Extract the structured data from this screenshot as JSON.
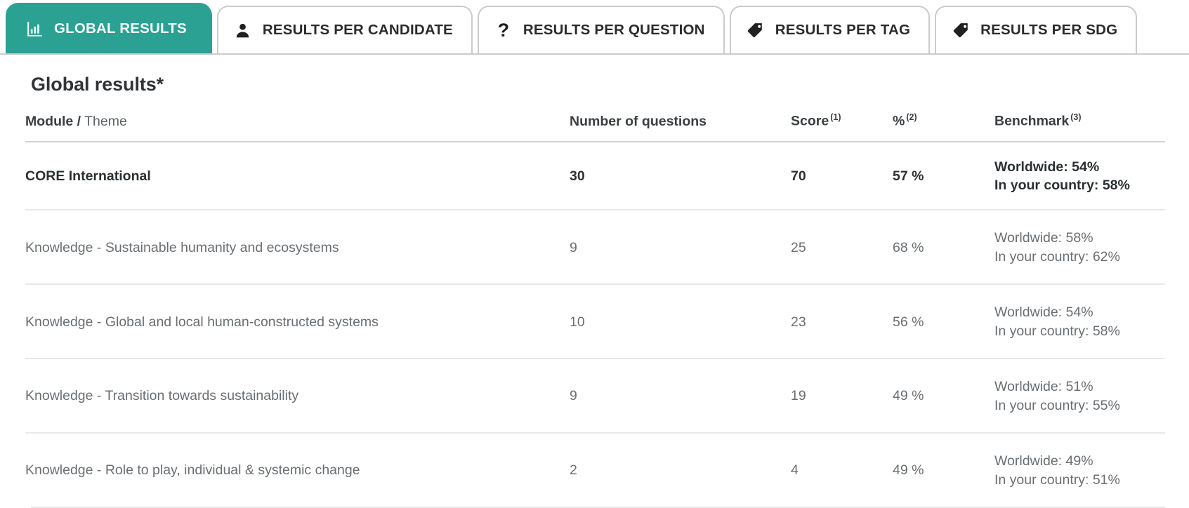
{
  "tabs": [
    {
      "label": "GLOBAL RESULTS",
      "icon": "bar-chart-icon",
      "active": true
    },
    {
      "label": "RESULTS PER CANDIDATE",
      "icon": "person-icon",
      "active": false
    },
    {
      "label": "RESULTS PER QUESTION",
      "icon": "question-mark-icon",
      "active": false
    },
    {
      "label": "RESULTS PER TAG",
      "icon": "tag-icon",
      "active": false
    },
    {
      "label": "RESULTS PER SDG",
      "icon": "tag-icon",
      "active": false
    }
  ],
  "page": {
    "title": "Global results*"
  },
  "table": {
    "headers": {
      "theme_strong": "Module /",
      "theme_light": " Theme",
      "questions": "Number of questions",
      "score": "Score",
      "score_note": "(1)",
      "pct": "%",
      "pct_note": "(2)",
      "benchmark": "Benchmark",
      "benchmark_note": "(3)"
    },
    "rows": [
      {
        "theme": "CORE International",
        "questions": "30",
        "score": "70",
        "pct": "57 %",
        "bench_world": "Worldwide: 54%",
        "bench_country": "In your country: 58%",
        "total": true
      },
      {
        "theme": "Knowledge - Sustainable humanity and ecosystems",
        "questions": "9",
        "score": "25",
        "pct": "68 %",
        "bench_world": "Worldwide: 58%",
        "bench_country": "In your country: 62%",
        "total": false
      },
      {
        "theme": "Knowledge - Global and local human-constructed systems",
        "questions": "10",
        "score": "23",
        "pct": "56 %",
        "bench_world": "Worldwide: 54%",
        "bench_country": "In your country: 58%",
        "total": false
      },
      {
        "theme": "Knowledge - Transition towards sustainability",
        "questions": "9",
        "score": "19",
        "pct": "49 %",
        "bench_world": "Worldwide: 51%",
        "bench_country": "In your country: 55%",
        "total": false
      },
      {
        "theme": "Knowledge - Role to play, individual & systemic change",
        "questions": "2",
        "score": "4",
        "pct": "49 %",
        "bench_world": "Worldwide: 49%",
        "bench_country": "In your country: 51%",
        "total": false
      }
    ]
  },
  "colors": {
    "active_tab": "#2ba193",
    "tab_border": "#c9ccce",
    "text_primary": "#2b3033",
    "text_secondary": "#6a6f73",
    "row_divider": "#e6e8ea"
  }
}
